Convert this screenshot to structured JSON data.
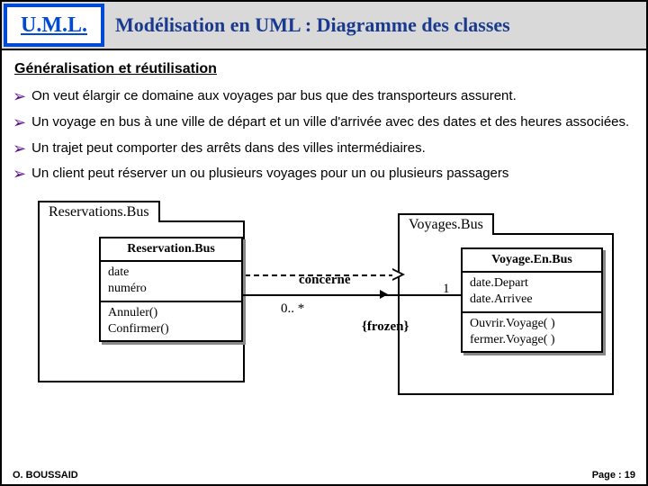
{
  "header": {
    "logo": "U.M.L.",
    "title": "Modélisation en UML : Diagramme des classes"
  },
  "subtitle": "Généralisation et réutilisation",
  "bullets": [
    "On veut élargir ce domaine aux voyages par bus que des transporteurs assurent.",
    "Un voyage en bus à une ville de départ et un ville d'arrivée avec des dates et des heures associées.",
    "Un trajet peut comporter des arrêts dans des villes intermédiaires.",
    "Un client peut réserver un ou plusieurs voyages pour un ou plusieurs passagers"
  ],
  "packages": {
    "left": "Reservations.Bus",
    "right": "Voyages.Bus"
  },
  "classLeft": {
    "name": "Reservation.Bus",
    "attrs": "date\nnuméro",
    "ops": "Annuler()\nConfirmer()"
  },
  "classRight": {
    "name": "Voyage.En.Bus",
    "attrs": "date.Depart\ndate.Arrivee",
    "ops": "Ouvrir.Voyage( )\nfermer.Voyage( )"
  },
  "assoc": {
    "name": "concerne",
    "multLeft": "0.. *",
    "multRight": "1",
    "constraint": "{frozen}"
  },
  "footer": {
    "left": "O. BOUSSAID",
    "right": "Page : 19"
  }
}
